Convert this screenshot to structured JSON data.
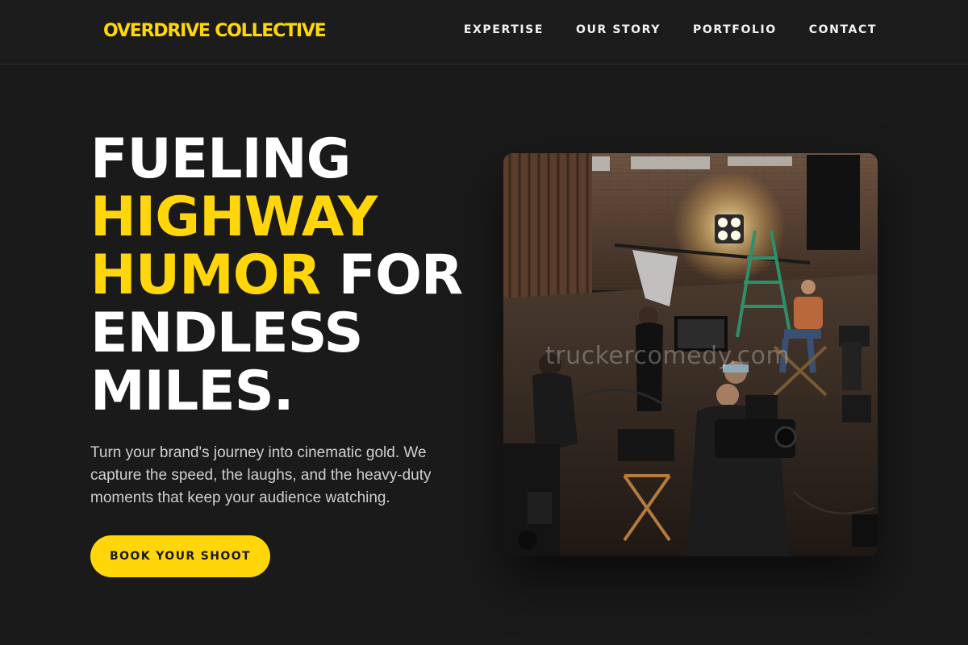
{
  "header": {
    "logo": "OVERDRIVE COLLECTIVE",
    "nav": [
      {
        "label": "EXPERTISE"
      },
      {
        "label": "OUR STORY"
      },
      {
        "label": "PORTFOLIO"
      },
      {
        "label": "CONTACT"
      }
    ]
  },
  "hero": {
    "title_line1": "FUELING",
    "title_line2": "HIGHWAY",
    "title_line3a": "HUMOR",
    "title_line3b": " FOR",
    "title_line4": "ENDLESS",
    "title_line5": "MILES.",
    "subtitle": "Turn your brand's journey into cinematic gold. We capture the speed, the laughs, and the heavy-duty moments that keep your audience watching.",
    "cta_label": "BOOK YOUR SHOOT"
  },
  "photo": {
    "watermark": "truckercomedy.com"
  },
  "colors": {
    "accent": "#ffd60a",
    "background": "#1a1a1a",
    "text": "#ffffff",
    "muted_text": "#cfcfcf"
  }
}
